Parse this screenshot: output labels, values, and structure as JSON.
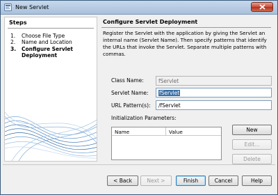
{
  "window": {
    "title": "New Servlet"
  },
  "steps": {
    "header": "Steps",
    "items": [
      {
        "num": "1.",
        "label": "Choose File Type"
      },
      {
        "num": "2.",
        "label": "Name and Location"
      },
      {
        "num": "3.",
        "label": "Configure Servlet",
        "label2": "Deployment"
      }
    ]
  },
  "main": {
    "title": "Configure Servlet Deployment",
    "description": "Register the Servlet with the application by giving the Servlet an internal name (Servlet Name). Then specify patterns that identify the URLs that invoke the Servlet. Separate multiple patterns with commas.",
    "class_name": {
      "label": "Class Name:",
      "value": "fServlet"
    },
    "servlet_name": {
      "label": "Servlet Name:",
      "value": "fServlet"
    },
    "url_pattern": {
      "label": "URL Pattern(s):",
      "value": "/fServlet"
    },
    "init_params": {
      "label": "Initialization Parameters:",
      "columns": [
        "Name",
        "Value"
      ],
      "rows": []
    },
    "buttons": {
      "new": "New",
      "edit": "Edit...",
      "delete": "Delete"
    }
  },
  "footer": {
    "back": "< Back",
    "next": "Next >",
    "finish": "Finish",
    "cancel": "Cancel",
    "help": "Help"
  }
}
